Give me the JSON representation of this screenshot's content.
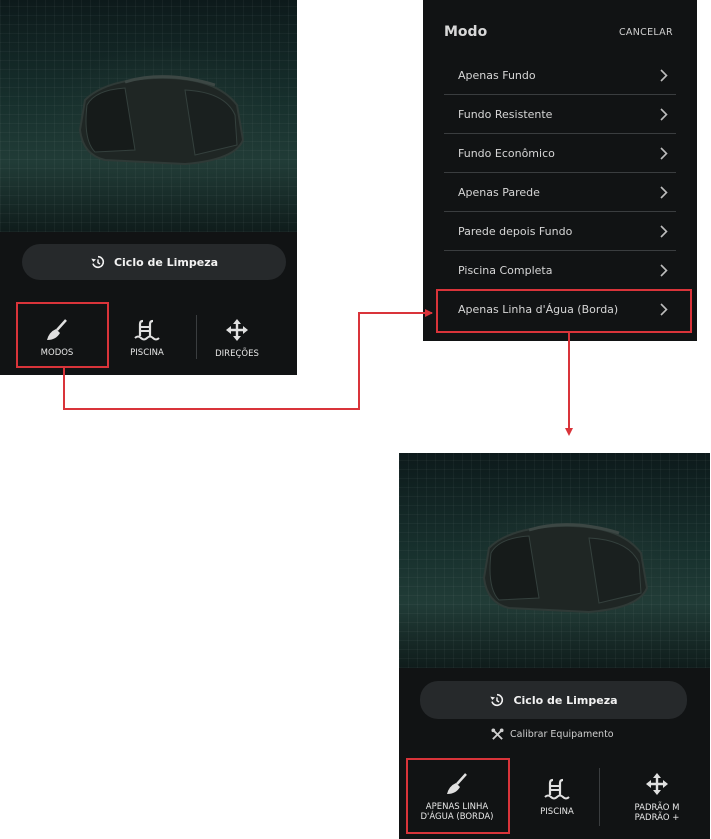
{
  "screen_before": {
    "ciclo_label": "Ciclo de Limpeza",
    "nav": [
      {
        "label": "MODOS",
        "icon": "broom-icon"
      },
      {
        "label": "PISCINA",
        "icon": "pool-icon"
      },
      {
        "label": "DIREÇÕES",
        "icon": "move-arrows-icon"
      }
    ]
  },
  "mode_menu": {
    "title": "Modo",
    "cancel_label": "CANCELAR",
    "items": [
      {
        "label": "Apenas Fundo"
      },
      {
        "label": "Fundo Resistente"
      },
      {
        "label": "Fundo Econômico"
      },
      {
        "label": "Apenas Parede"
      },
      {
        "label": "Parede depois Fundo"
      },
      {
        "label": "Piscina Completa"
      },
      {
        "label": "Apenas Linha d'Água (Borda)"
      }
    ],
    "selected_item": "Apenas Linha d'Água (Borda)"
  },
  "screen_after": {
    "ciclo_label": "Ciclo de Limpeza",
    "calibrate_label": "Calibrar Equipamento",
    "nav": [
      {
        "label_line1": "APENAS LINHA",
        "label_line2": "D'ÁGUA (BORDA)",
        "icon": "broom-icon"
      },
      {
        "label_line1": "PISCINA",
        "label_line2": "",
        "icon": "pool-icon"
      },
      {
        "label_line1": "PADRÃO M",
        "label_line2": "PADRÃO +",
        "icon": "move-arrows-icon"
      }
    ]
  },
  "colors": {
    "panel_bg": "#111314",
    "button_bg": "#26292b",
    "highlight": "#d9343a",
    "text": "#e8e8e8"
  }
}
